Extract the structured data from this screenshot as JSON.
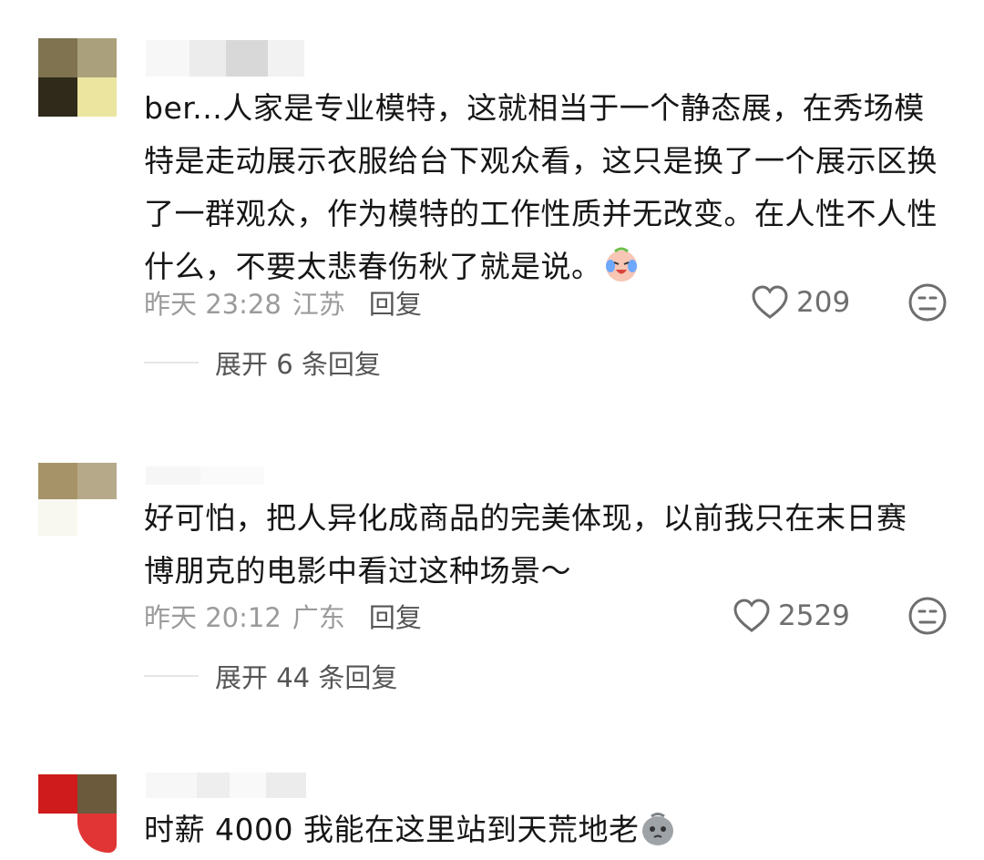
{
  "comments": [
    {
      "text": "ber...人家是专业模特，这就相当于一个静态展，在秀场模特是走动展示衣服给台下观众看，这只是换了一个展示区换了一群观众，作为模特的工作性质并无改变。在人性不人性什么，不要太悲春伤秋了就是说。",
      "emoji": "laugh-cry-emoji",
      "time": "昨天 23:28",
      "location": "江苏",
      "reply_label": "回复",
      "likes": "209",
      "expand_label": "展开 6 条回复",
      "avatar_colors": [
        "#7f7350",
        "#aaa17c",
        "#2f2a19",
        "#ece5a0"
      ]
    },
    {
      "text": "好可怕，把人异化成商品的完美体现，以前我只在末日赛博朋克的电影中看过这种场景～",
      "time": "昨天 20:12",
      "location": "广东",
      "reply_label": "回复",
      "likes": "2529",
      "expand_label": "展开 44 条回复",
      "avatar_colors": [
        "#a69468",
        "#b6a98a",
        "#f8f8f1",
        "#ffffff"
      ]
    },
    {
      "text": "时薪 4000 我能在这里站到天荒地老",
      "emoji": "sad-face-emoji",
      "avatar_colors": [
        "#cf1b1b",
        "#6b5a3c",
        "#ffffff",
        "#e13535"
      ]
    }
  ],
  "icons": {
    "like": "heart-outline-icon",
    "dislike": "neutral-face-icon"
  }
}
